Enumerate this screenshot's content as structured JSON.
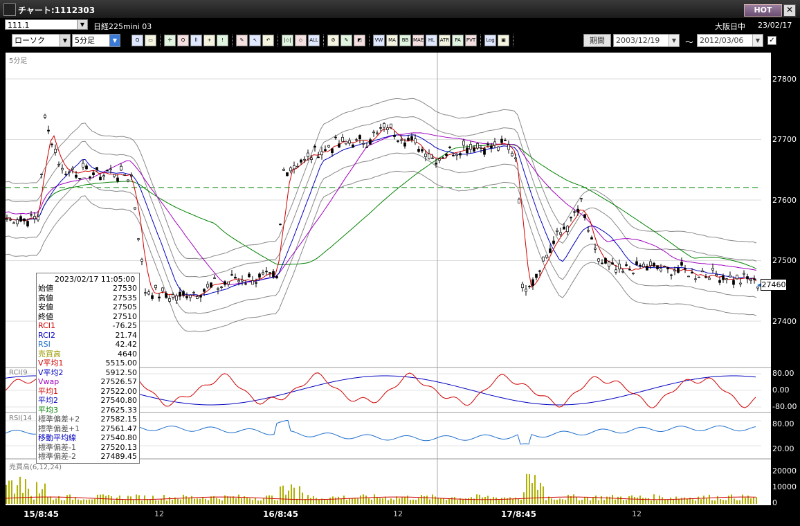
{
  "window": {
    "title": "チャート:1112303",
    "hot_label": "HOT",
    "close_label": "✕"
  },
  "symbol_bar": {
    "code": "111.1",
    "name": "日経225mini 03",
    "market": "大阪日中",
    "date": "23/02/17"
  },
  "toolbar": {
    "chart_type": "ローソク",
    "interval": "5分足",
    "period_label": "期間",
    "date_from": "2003/12/19",
    "date_to": "2012/03/06",
    "tilde": "〜",
    "icons": [
      {
        "name": "zoom-icon",
        "label": "Q"
      },
      {
        "name": "window-icon",
        "label": "▭"
      },
      {
        "name": "crosshair-icon",
        "label": "✛"
      },
      {
        "name": "chart-q-icon",
        "label": "Q"
      },
      {
        "name": "chart-bars-icon",
        "label": "ll"
      },
      {
        "name": "chart-split-icon",
        "label": "+"
      },
      {
        "name": "chart-lock-icon",
        "label": "!"
      },
      {
        "name": "pencil-icon",
        "label": "✎"
      },
      {
        "name": "arrow-cursor-icon",
        "label": "↖"
      },
      {
        "name": "undo-icon",
        "label": "↶"
      },
      {
        "name": "scale-in-icon",
        "label": "|◇|"
      },
      {
        "name": "scale-out-icon",
        "label": "◇"
      },
      {
        "name": "all-icon",
        "label": "ALL"
      },
      {
        "name": "settings-icon",
        "label": "⚙"
      },
      {
        "name": "wrench-icon",
        "label": "✎"
      },
      {
        "name": "color-icon",
        "label": "◩"
      },
      {
        "name": "indicator-vw-icon",
        "label": "VW"
      },
      {
        "name": "indicator-ma-icon",
        "label": "MA"
      },
      {
        "name": "indicator-bb-icon",
        "label": "BB"
      },
      {
        "name": "indicator-mae-icon",
        "label": "MAE"
      },
      {
        "name": "indicator-hl-icon",
        "label": "HL"
      },
      {
        "name": "indicator-atr-icon",
        "label": "ATR"
      },
      {
        "name": "indicator-pa-icon",
        "label": "PA"
      },
      {
        "name": "indicator-pvt-icon",
        "label": "PVT"
      },
      {
        "name": "log-icon",
        "label": "Log"
      },
      {
        "name": "export-icon",
        "label": "▣"
      }
    ]
  },
  "chart": {
    "main_label": "5分足",
    "rci_label": "RCI(9",
    "rsi_label": "RSI(14",
    "vol_label": "売買高(6,12,24)",
    "price_axis": [
      "27800",
      "27700",
      "27600",
      "27500",
      "27400"
    ],
    "rci_axis": [
      "80.00",
      "0.00",
      "-80.00"
    ],
    "rsi_axis": [
      "80.00",
      "20.00"
    ],
    "vol_axis": [
      "20000",
      "10000",
      "0"
    ],
    "last_price": "27460",
    "x_labels": [
      "15/8:45",
      "12",
      "16/8:45",
      "12",
      "17/8:45",
      "12"
    ]
  },
  "infobox": {
    "datetime": "2023/02/17  11:05:00",
    "rows": [
      {
        "k": "始値",
        "v": "27530",
        "c": "#000"
      },
      {
        "k": "高値",
        "v": "27535",
        "c": "#000"
      },
      {
        "k": "安値",
        "v": "27505",
        "c": "#000"
      },
      {
        "k": "終値",
        "v": "27510",
        "c": "#000"
      },
      {
        "k": "RCI1",
        "v": "-76.25",
        "c": "#d00000"
      },
      {
        "k": "RCI2",
        "v": "21.74",
        "c": "#0000c0"
      },
      {
        "k": "RSI",
        "v": "42.42",
        "c": "#1e6ecc"
      },
      {
        "k": "売買高",
        "v": "4640",
        "c": "#9a9a00"
      },
      {
        "k": "V平均1",
        "v": "5515.00",
        "c": "#d00000"
      },
      {
        "k": "V平均2",
        "v": "5912.50",
        "c": "#0000c0"
      },
      {
        "k": "Vwap",
        "v": "27526.57",
        "c": "#a000c0"
      },
      {
        "k": "平均1",
        "v": "27522.00",
        "c": "#d00000"
      },
      {
        "k": "平均2",
        "v": "27540.80",
        "c": "#0000c0"
      },
      {
        "k": "平均3",
        "v": "27625.33",
        "c": "#008000"
      },
      {
        "k": "標準偏差+2",
        "v": "27582.15",
        "c": "#555"
      },
      {
        "k": "標準偏差+1",
        "v": "27561.47",
        "c": "#555"
      },
      {
        "k": "移動平均線",
        "v": "27540.80",
        "c": "#0000c0"
      },
      {
        "k": "標準偏差-1",
        "v": "27520.13",
        "c": "#555"
      },
      {
        "k": "標準偏差-2",
        "v": "27489.45",
        "c": "#555"
      }
    ]
  },
  "colors": {
    "ma1": "#d00000",
    "ma2": "#0000c0",
    "ma3": "#008000",
    "vwap": "#a000c0",
    "band": "#777777",
    "volume": "#b0b000"
  }
}
